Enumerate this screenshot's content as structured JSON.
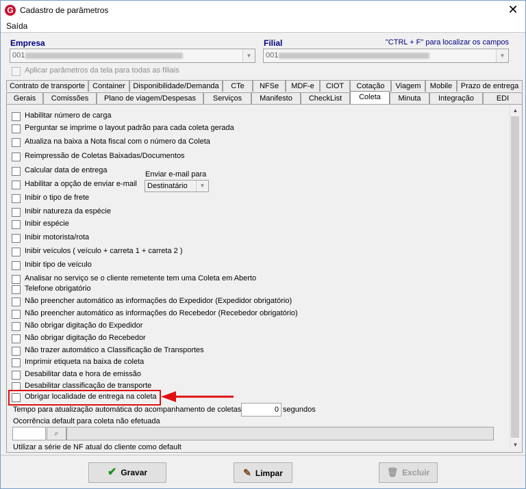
{
  "window": {
    "title": "Cadastro de parâmetros",
    "menu": "Saída"
  },
  "empresa": {
    "label": "Empresa",
    "code": "001"
  },
  "filial": {
    "label": "Filial",
    "code": "001"
  },
  "hint": "\"CTRL + F\" para localizar os campos",
  "apply_all": "Aplicar parâmetros da tela para todas as filiais",
  "tabs_row1": [
    "Contrato de transporte",
    "Container",
    "Disponibilidade/Demanda",
    "CTe",
    "NFSe",
    "MDF-e",
    "CIOT",
    "Cotação",
    "Viagem",
    "Mobile",
    "Prazo de entrega"
  ],
  "tabs_row2": [
    "Gerais",
    "Comissões",
    "Plano de viagem/Despesas",
    "Serviços",
    "Manifesto",
    "CheckList",
    "Coleta",
    "Minuta",
    "Integração",
    "EDI"
  ],
  "active_tab": "Coleta",
  "options": [
    "Habilitar número de carga",
    "Perguntar se imprime o layout padrão para cada coleta gerada",
    "Atualiza na baixa a Nota fiscal com o número da Coleta",
    "Reimpressão de Coletas Baixadas/Documentos",
    "Calcular data de entrega",
    "Habilitar a opção de enviar e-mail",
    "Inibir o tipo de frete",
    "Inibir natureza da espécie",
    "Inibir espécie",
    "Inibir motorista/rota",
    "Inibir veículos ( veículo + carreta 1 + carreta 2 )",
    "Inibir tipo de veículo",
    "Analisar no serviço se o cliente remetente tem uma Coleta em Aberto",
    "Telefone obrigatório",
    "Não preencher automático as informações do Expedidor (Expedidor obrigatório)",
    "Não preencher automático as informações do Recebedor (Recebedor obrigatório)",
    "Não obrigar digitação do Expedidor",
    "Não obrigar digitação do Recebedor",
    "Não trazer automático a Classificação de Transportes",
    "Imprimir etiqueta na baixa de coleta",
    "Desabilitar data e hora de emissão",
    "Desabilitar classificação de transporte",
    "Obrigar localidade de entrega na coleta"
  ],
  "email": {
    "label": "Enviar e-mail para",
    "value": "Destinatário"
  },
  "update_time": {
    "label": "Tempo para atualização automática do acompanhamento de coletas",
    "value": "0",
    "unit": "segundos"
  },
  "default_occurrence": {
    "label": "Ocorrência default para coleta não efetuada"
  },
  "nf_series": "Utilizar a série de NF atual do cliente  como default",
  "buttons": {
    "save": "Gravar",
    "clear": "Limpar",
    "delete": "Excluir"
  }
}
